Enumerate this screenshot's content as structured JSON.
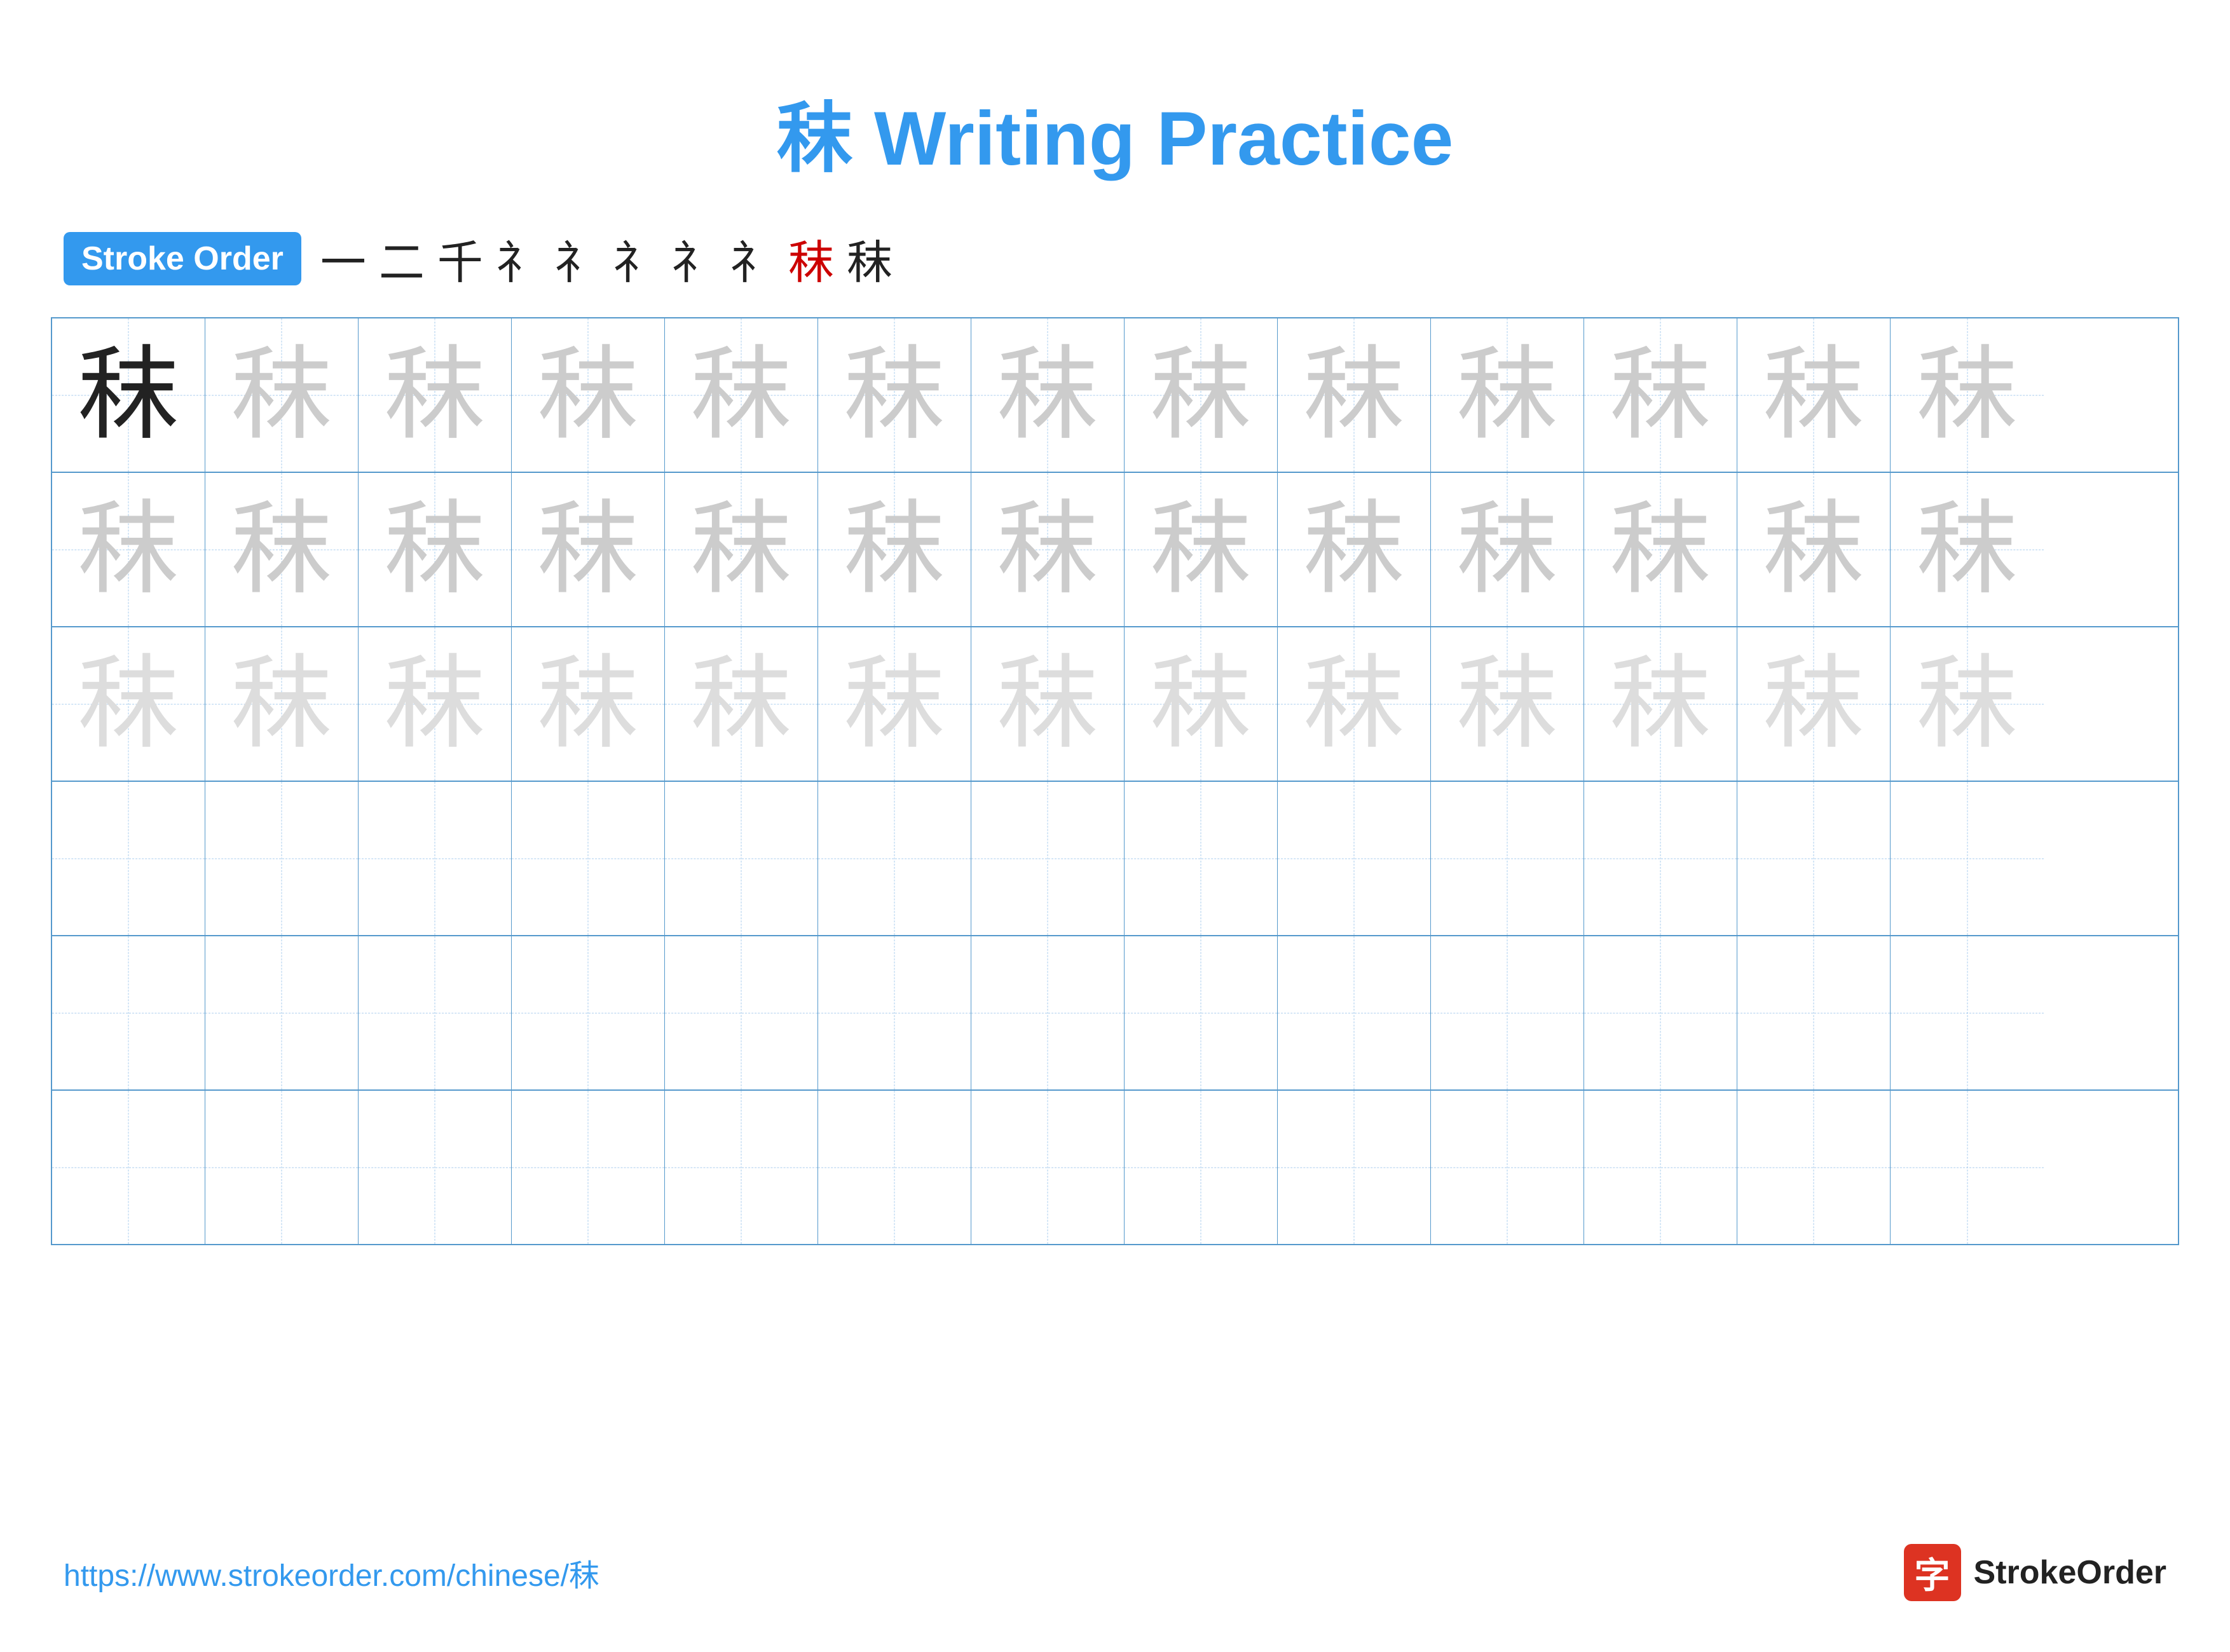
{
  "title": {
    "chinese_char": "秣",
    "text": " Writing Practice",
    "full": "秣 Writing Practice"
  },
  "stroke_order": {
    "badge_label": "Stroke Order",
    "steps": [
      "一",
      "二",
      "千",
      "礻",
      "礻",
      "礻",
      "礻",
      "礻",
      "秣",
      "秣"
    ],
    "highlight_index": 8
  },
  "grid": {
    "rows": 6,
    "cols": 13,
    "character": "秣",
    "row_styles": [
      "dark",
      "medium",
      "light",
      "empty",
      "empty",
      "empty"
    ]
  },
  "footer": {
    "url": "https://www.strokeorder.com/chinese/秣",
    "brand_char": "字",
    "brand_name": "StrokeOrder"
  }
}
